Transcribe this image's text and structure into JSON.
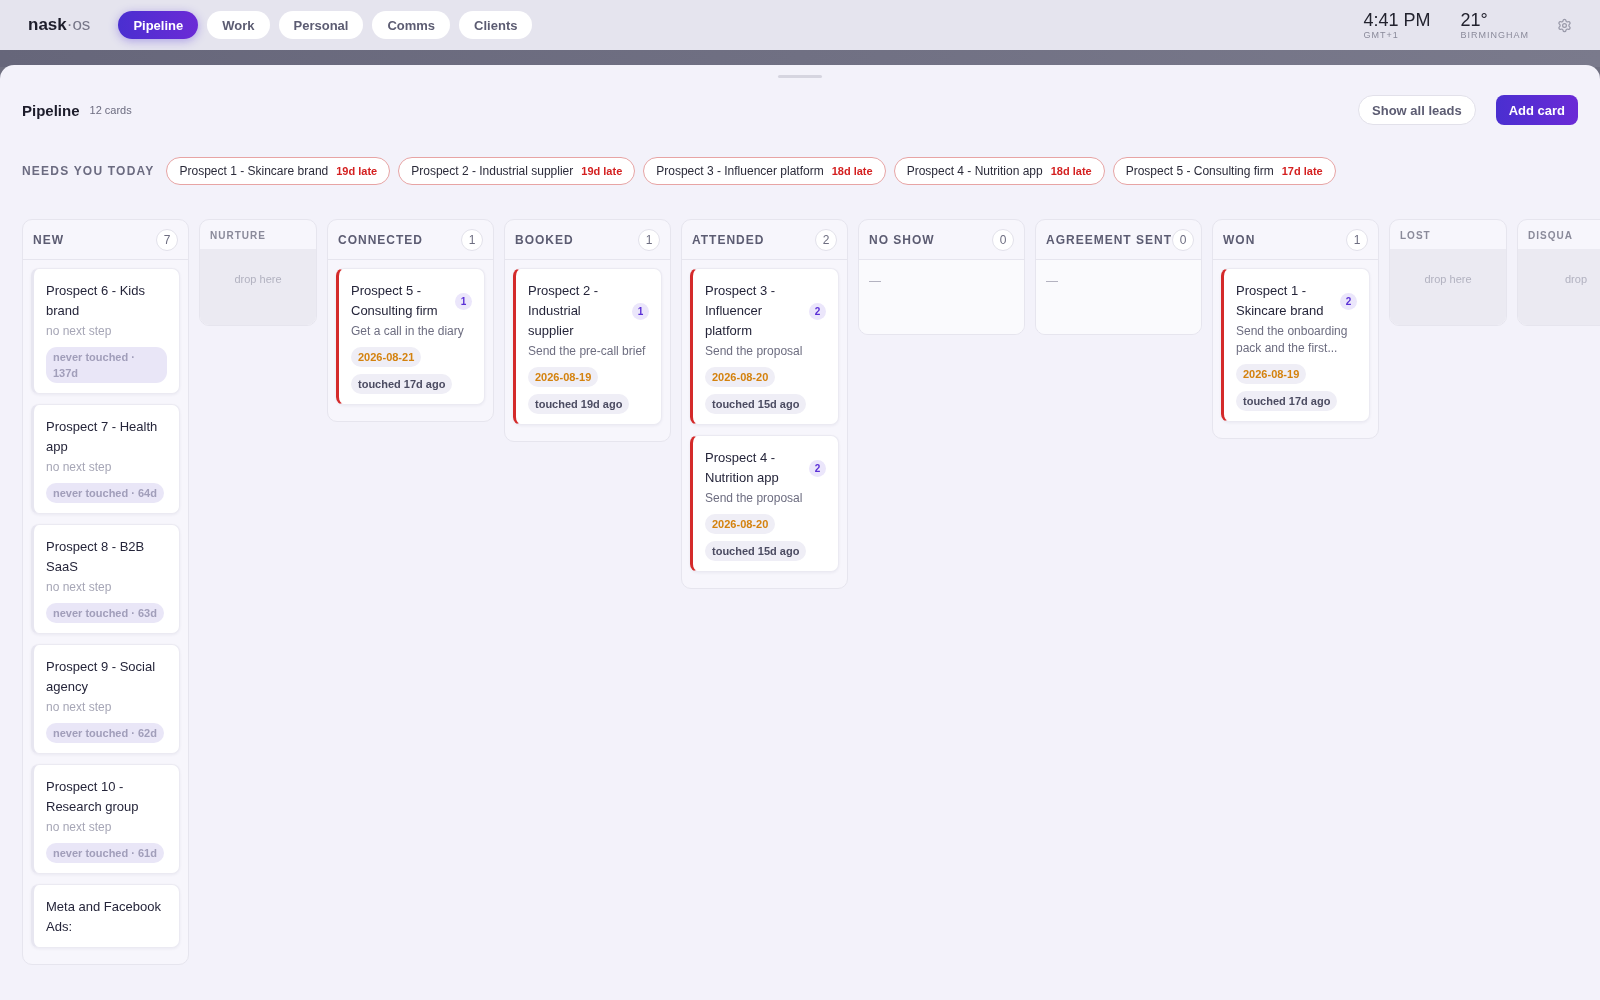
{
  "logo": {
    "primary": "nask",
    "secondary": "·os"
  },
  "nav": [
    {
      "label": "Pipeline",
      "selected": true
    },
    {
      "label": "Work",
      "selected": false
    },
    {
      "label": "Personal",
      "selected": false
    },
    {
      "label": "Comms",
      "selected": false
    },
    {
      "label": "Clients",
      "selected": false
    }
  ],
  "clock": {
    "time": "4:41 PM",
    "zone": "GMT+1"
  },
  "weather": {
    "temp": "21°",
    "city": "BIRMINGHAM"
  },
  "header": {
    "title": "Pipeline",
    "count": "12 cards",
    "actions": [
      {
        "label": "Show all leads",
        "kind": "secondary"
      },
      {
        "label": "Add card",
        "kind": "primary"
      }
    ]
  },
  "needs_today": {
    "label": "NEEDS YOU TODAY",
    "items": [
      {
        "name": "Prospect 1 - Skincare brand",
        "late": "19d late"
      },
      {
        "name": "Prospect 2 - Industrial supplier",
        "late": "19d late"
      },
      {
        "name": "Prospect 3 - Influencer platform",
        "late": "18d late"
      },
      {
        "name": "Prospect 4 - Nutrition app",
        "late": "18d late"
      },
      {
        "name": "Prospect 5 - Consulting firm",
        "late": "17d late"
      }
    ]
  },
  "columns": [
    {
      "name": "NEW",
      "kind": "list",
      "count": "7",
      "cards": [
        {
          "title": "Prospect 6 - Kids brand",
          "next": "no next step",
          "overdue": false,
          "never_touched": true,
          "touched": "never touched · 137d"
        },
        {
          "title": "Prospect 7 - Health app",
          "next": "no next step",
          "overdue": false,
          "never_touched": true,
          "touched": "never touched · 64d"
        },
        {
          "title": "Prospect 8 - B2B SaaS",
          "next": "no next step",
          "overdue": false,
          "never_touched": true,
          "touched": "never touched · 63d"
        },
        {
          "title": "Prospect 9 - Social agency",
          "next": "no next step",
          "overdue": false,
          "never_touched": true,
          "touched": "never touched · 62d"
        },
        {
          "title": "Prospect 10 - Research group",
          "next": "no next step",
          "overdue": false,
          "never_touched": true,
          "touched": "never touched · 61d"
        },
        {
          "title": "Meta and Facebook Ads:",
          "overdue": false
        }
      ]
    },
    {
      "name": "NURTURE",
      "kind": "drop",
      "hint": "drop here"
    },
    {
      "name": "CONNECTED",
      "kind": "list",
      "count": "1",
      "cards": [
        {
          "title": "Prospect 5 - Consulting firm",
          "badge": "1",
          "next": "Get a call in the diary",
          "due": "2026-08-21",
          "overdue": true,
          "never_touched": false,
          "touched": "touched 17d ago"
        }
      ]
    },
    {
      "name": "BOOKED",
      "kind": "list",
      "count": "1",
      "cards": [
        {
          "title": "Prospect 2 - Industrial supplier",
          "badge": "1",
          "next": "Send the pre-call brief",
          "due": "2026-08-19",
          "overdue": true,
          "never_touched": false,
          "touched": "touched 19d ago"
        }
      ]
    },
    {
      "name": "ATTENDED",
      "kind": "list",
      "count": "2",
      "cards": [
        {
          "title": "Prospect 3 - Influencer platform",
          "badge": "2",
          "next": "Send the proposal",
          "due": "2026-08-20",
          "overdue": true,
          "never_touched": false,
          "touched": "touched 15d ago"
        },
        {
          "title": "Prospect 4 - Nutrition app",
          "badge": "2",
          "next": "Send the proposal",
          "due": "2026-08-20",
          "overdue": true,
          "never_touched": false,
          "touched": "touched 15d ago"
        }
      ]
    },
    {
      "name": "NO SHOW",
      "kind": "empty",
      "count": "0",
      "placeholder": "—"
    },
    {
      "name": "AGREEMENT SENT",
      "kind": "empty",
      "count": "0",
      "placeholder": "—"
    },
    {
      "name": "WON",
      "kind": "list",
      "count": "1",
      "cards": [
        {
          "title": "Prospect 1 - Skincare brand",
          "badge": "2",
          "next": "Send the onboarding pack and the first...",
          "due": "2026-08-19",
          "overdue": true,
          "never_touched": false,
          "touched": "touched 17d ago"
        }
      ]
    },
    {
      "name": "LOST",
      "kind": "drop",
      "hint": "drop here"
    },
    {
      "name": "DISQUA",
      "kind": "drop",
      "hint": "drop"
    }
  ]
}
